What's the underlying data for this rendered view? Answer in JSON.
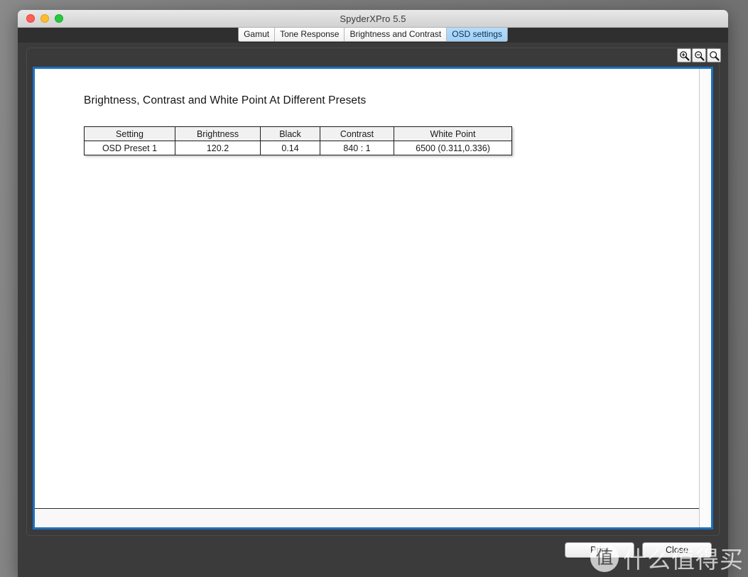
{
  "window": {
    "title": "SpyderXPro 5.5",
    "controls": {
      "close": "close-window",
      "minimize": "minimize-window",
      "maximize": "maximize-window"
    }
  },
  "tabs": [
    {
      "label": "Gamut",
      "active": false
    },
    {
      "label": "Tone Response",
      "active": false
    },
    {
      "label": "Brightness and Contrast",
      "active": false
    },
    {
      "label": "OSD settings",
      "active": true
    }
  ],
  "toolbar": {
    "zoom_in": "zoom-in-icon",
    "zoom_out": "zoom-out-icon",
    "zoom_reset": "zoom-actual-icon"
  },
  "document": {
    "heading": "Brightness, Contrast and White Point At Different Presets",
    "table": {
      "columns": [
        "Setting",
        "Brightness",
        "Black",
        "Contrast",
        "White Point"
      ],
      "rows": [
        [
          "OSD Preset 1",
          "120.2",
          "0.14",
          "840 : 1",
          "6500 (0.311,0.336)"
        ]
      ]
    }
  },
  "actions": {
    "print": "Print",
    "close": "Close"
  },
  "watermark": {
    "badge": "值",
    "text": "什么值得买"
  },
  "colors": {
    "accent_blue": "#1d6fc0",
    "tab_active_bg": "#a8d5fa",
    "panel_dark": "#3b3b3b",
    "titlebar": "#dcdcdc",
    "desktop": "#7b7b7b"
  }
}
